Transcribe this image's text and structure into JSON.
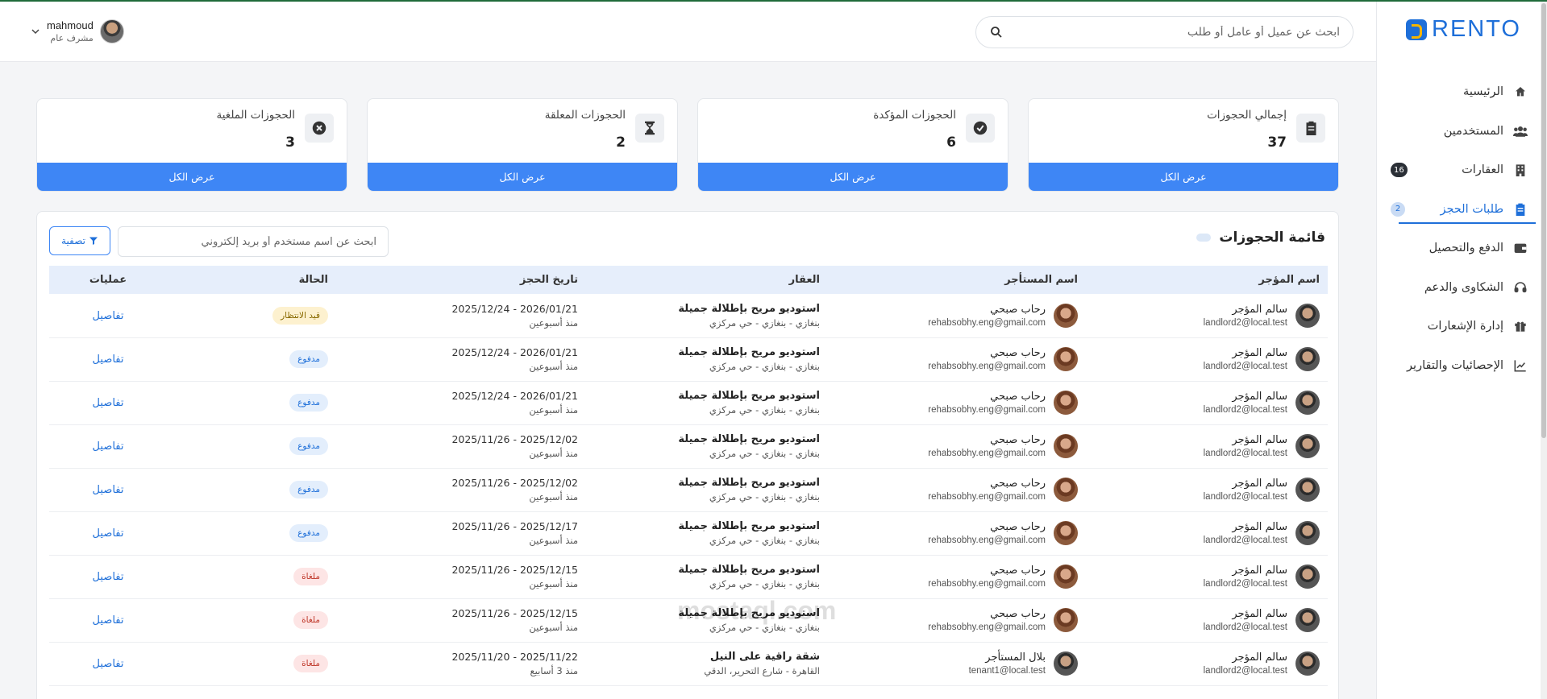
{
  "brand": {
    "name": "RENTO"
  },
  "header": {
    "search_placeholder": "ابحث عن عميل أو عامل أو طلب",
    "user_name": "mahmoud",
    "user_role": "مشرف عام"
  },
  "sidebar": {
    "items": [
      {
        "label": "الرئيسية",
        "icon": "home-icon"
      },
      {
        "label": "المستخدمين",
        "icon": "users-icon"
      },
      {
        "label": "العقارات",
        "icon": "building-icon",
        "badge": "16"
      },
      {
        "label": "طلبات الحجز",
        "icon": "clipboard-icon",
        "badge": "2",
        "active": true
      },
      {
        "label": "الدفع والتحصيل",
        "icon": "wallet-icon"
      },
      {
        "label": "الشكاوى والدعم",
        "icon": "headset-icon"
      },
      {
        "label": "إدارة الإشعارات",
        "icon": "gift-icon"
      },
      {
        "label": "الإحصائيات والتقارير",
        "icon": "chart-icon"
      }
    ]
  },
  "cards": [
    {
      "title": "إجمالي الحجوزات",
      "value": "37",
      "icon": "clipboard-icon",
      "button": "عرض الكل"
    },
    {
      "title": "الحجوزات المؤكدة",
      "value": "6",
      "icon": "check-circle-icon",
      "button": "عرض الكل"
    },
    {
      "title": "الحجوزات المعلقة",
      "value": "2",
      "icon": "hourglass-icon",
      "button": "عرض الكل"
    },
    {
      "title": "الحجوزات الملغية",
      "value": "3",
      "icon": "x-circle-icon",
      "button": "عرض الكل"
    }
  ],
  "bookings": {
    "title": "قائمة الحجوزات",
    "search_placeholder": "ابحث عن اسم مستخدم أو بريد إلكتروني",
    "filter_label": "تصفية",
    "columns": [
      "اسم المؤجر",
      "اسم المستأجر",
      "العقار",
      "تاريخ الحجز",
      "الحالة",
      "عمليات"
    ],
    "rows": [
      {
        "landlord": "سالم المؤجر",
        "landlord_email": "landlord2@local.test",
        "tenant": "رحاب صبحي",
        "tenant_email": "rehabsobhy.eng@gmail.com",
        "property": "استوديو مريح بإطلالة جميلة",
        "location": "بنغازي - بنغازي - حي مركزي",
        "dates": "2025/12/24 - 2026/01/21",
        "ago": "منذ أسبوعين",
        "status": "قيد الانتظار",
        "status_type": "wait",
        "action": "تفاصيل"
      },
      {
        "landlord": "سالم المؤجر",
        "landlord_email": "landlord2@local.test",
        "tenant": "رحاب صبحي",
        "tenant_email": "rehabsobhy.eng@gmail.com",
        "property": "استوديو مريح بإطلالة جميلة",
        "location": "بنغازي - بنغازي - حي مركزي",
        "dates": "2025/12/24 - 2026/01/21",
        "ago": "منذ أسبوعين",
        "status": "مدفوع",
        "status_type": "paid",
        "action": "تفاصيل"
      },
      {
        "landlord": "سالم المؤجر",
        "landlord_email": "landlord2@local.test",
        "tenant": "رحاب صبحي",
        "tenant_email": "rehabsobhy.eng@gmail.com",
        "property": "استوديو مريح بإطلالة جميلة",
        "location": "بنغازي - بنغازي - حي مركزي",
        "dates": "2025/12/24 - 2026/01/21",
        "ago": "منذ أسبوعين",
        "status": "مدفوع",
        "status_type": "paid",
        "action": "تفاصيل"
      },
      {
        "landlord": "سالم المؤجر",
        "landlord_email": "landlord2@local.test",
        "tenant": "رحاب صبحي",
        "tenant_email": "rehabsobhy.eng@gmail.com",
        "property": "استوديو مريح بإطلالة جميلة",
        "location": "بنغازي - بنغازي - حي مركزي",
        "dates": "2025/11/26 - 2025/12/02",
        "ago": "منذ أسبوعين",
        "status": "مدفوع",
        "status_type": "paid",
        "action": "تفاصيل"
      },
      {
        "landlord": "سالم المؤجر",
        "landlord_email": "landlord2@local.test",
        "tenant": "رحاب صبحي",
        "tenant_email": "rehabsobhy.eng@gmail.com",
        "property": "استوديو مريح بإطلالة جميلة",
        "location": "بنغازي - بنغازي - حي مركزي",
        "dates": "2025/11/26 - 2025/12/02",
        "ago": "منذ أسبوعين",
        "status": "مدفوع",
        "status_type": "paid",
        "action": "تفاصيل"
      },
      {
        "landlord": "سالم المؤجر",
        "landlord_email": "landlord2@local.test",
        "tenant": "رحاب صبحي",
        "tenant_email": "rehabsobhy.eng@gmail.com",
        "property": "استوديو مريح بإطلالة جميلة",
        "location": "بنغازي - بنغازي - حي مركزي",
        "dates": "2025/11/26 - 2025/12/17",
        "ago": "منذ أسبوعين",
        "status": "مدفوع",
        "status_type": "paid",
        "action": "تفاصيل"
      },
      {
        "landlord": "سالم المؤجر",
        "landlord_email": "landlord2@local.test",
        "tenant": "رحاب صبحي",
        "tenant_email": "rehabsobhy.eng@gmail.com",
        "property": "استوديو مريح بإطلالة جميلة",
        "location": "بنغازي - بنغازي - حي مركزي",
        "dates": "2025/11/26 - 2025/12/15",
        "ago": "منذ أسبوعين",
        "status": "ملغاة",
        "status_type": "cancel",
        "action": "تفاصيل"
      },
      {
        "landlord": "سالم المؤجر",
        "landlord_email": "landlord2@local.test",
        "tenant": "رحاب صبحي",
        "tenant_email": "rehabsobhy.eng@gmail.com",
        "property": "استوديو مريح بإطلالة جميلة",
        "location": "بنغازي - بنغازي - حي مركزي",
        "dates": "2025/11/26 - 2025/12/15",
        "ago": "منذ أسبوعين",
        "status": "ملغاة",
        "status_type": "cancel",
        "action": "تفاصيل"
      },
      {
        "landlord": "سالم المؤجر",
        "landlord_email": "landlord2@local.test",
        "tenant": "بلال المستأجر",
        "tenant_email": "tenant1@local.test",
        "property": "شقة راقية على النيل",
        "location": "القاهرة - شارع التحرير، الدقي",
        "dates": "2025/11/20 - 2025/11/22",
        "ago": "منذ 3 أسابيع",
        "status": "ملغاة",
        "status_type": "cancel",
        "action": "تفاصيل"
      }
    ]
  },
  "watermark": "mostaql.com"
}
